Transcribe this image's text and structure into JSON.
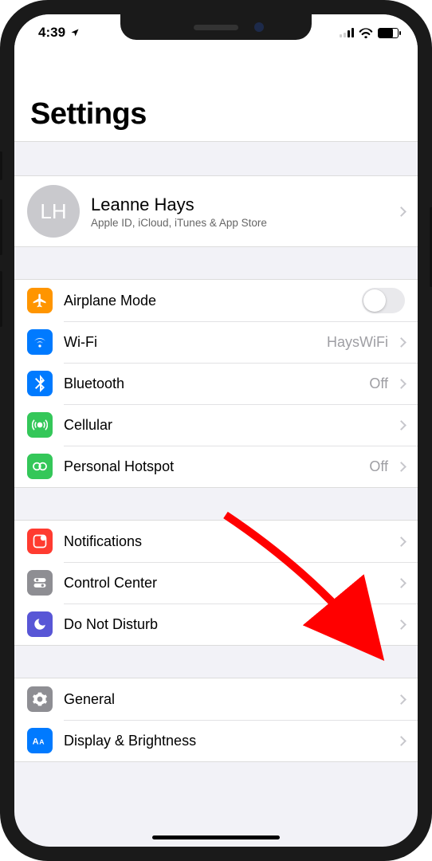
{
  "status": {
    "time": "4:39",
    "location_icon": "location"
  },
  "header": {
    "title": "Settings"
  },
  "account": {
    "initials": "LH",
    "name": "Leanne Hays",
    "subtitle": "Apple ID, iCloud, iTunes & App Store"
  },
  "groups": [
    {
      "items": [
        {
          "icon": "airplane",
          "color": "bg-orange",
          "label": "Airplane Mode",
          "type": "switch",
          "switch_on": false
        },
        {
          "icon": "wifi",
          "color": "bg-blue",
          "label": "Wi-Fi",
          "type": "link",
          "value": "HaysWiFi"
        },
        {
          "icon": "bluetooth",
          "color": "bg-blue",
          "label": "Bluetooth",
          "type": "link",
          "value": "Off"
        },
        {
          "icon": "cellular",
          "color": "bg-green",
          "label": "Cellular",
          "type": "link",
          "value": ""
        },
        {
          "icon": "hotspot",
          "color": "bg-green",
          "label": "Personal Hotspot",
          "type": "link",
          "value": "Off"
        }
      ]
    },
    {
      "items": [
        {
          "icon": "notifications",
          "color": "bg-red",
          "label": "Notifications",
          "type": "link",
          "value": ""
        },
        {
          "icon": "controlcenter",
          "color": "bg-gray",
          "label": "Control Center",
          "type": "link",
          "value": ""
        },
        {
          "icon": "dnd",
          "color": "bg-indigo",
          "label": "Do Not Disturb",
          "type": "link",
          "value": ""
        }
      ]
    },
    {
      "items": [
        {
          "icon": "general",
          "color": "bg-gray",
          "label": "General",
          "type": "link",
          "value": ""
        },
        {
          "icon": "display",
          "color": "bg-blue",
          "label": "Display & Brightness",
          "type": "link",
          "value": ""
        }
      ]
    }
  ],
  "annotation": {
    "arrow_color": "#ff0000"
  }
}
